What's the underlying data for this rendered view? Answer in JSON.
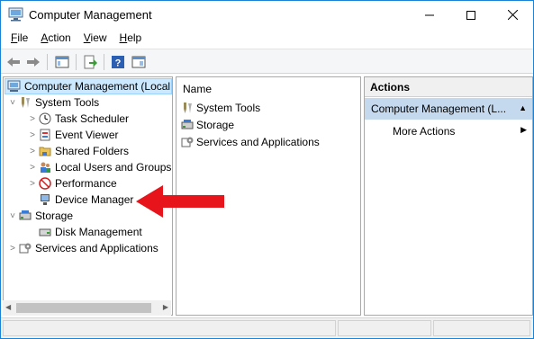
{
  "window": {
    "title": "Computer Management",
    "controls": {
      "minimize": "—",
      "maximize": "☐",
      "close": "✕"
    }
  },
  "menu": [
    {
      "label": "File",
      "key": "F",
      "rest": "ile"
    },
    {
      "label": "Action",
      "key": "A",
      "rest": "ction"
    },
    {
      "label": "View",
      "key": "V",
      "rest": "iew"
    },
    {
      "label": "Help",
      "key": "H",
      "rest": "elp"
    }
  ],
  "toolbar": {
    "buttons": [
      "back-icon",
      "forward-icon",
      "show-hide-console-tree-icon",
      "export-list-icon",
      "help-icon",
      "show-hide-action-pane-icon"
    ]
  },
  "tree": {
    "root": {
      "label": "Computer Management (Local",
      "icon": "computer-management-icon"
    },
    "items": [
      {
        "label": "System Tools",
        "icon": "system-tools-icon",
        "arrow": "˅"
      },
      {
        "label": "Task Scheduler",
        "icon": "clock-icon",
        "arrow": ">"
      },
      {
        "label": "Event Viewer",
        "icon": "event-viewer-icon",
        "arrow": ">"
      },
      {
        "label": "Shared Folders",
        "icon": "shared-folder-icon",
        "arrow": ">"
      },
      {
        "label": "Local Users and Groups",
        "icon": "users-icon",
        "arrow": ">"
      },
      {
        "label": "Performance",
        "icon": "performance-icon",
        "arrow": ">"
      },
      {
        "label": "Device Manager",
        "icon": "device-manager-icon",
        "arrow": ""
      },
      {
        "label": "Storage",
        "icon": "storage-icon",
        "arrow": "˅"
      },
      {
        "label": "Disk Management",
        "icon": "disk-management-icon",
        "arrow": ""
      },
      {
        "label": "Services and Applications",
        "icon": "services-icon",
        "arrow": ">"
      }
    ]
  },
  "list": {
    "column": "Name",
    "rows": [
      {
        "label": "System Tools",
        "icon": "system-tools-icon"
      },
      {
        "label": "Storage",
        "icon": "storage-icon"
      },
      {
        "label": "Services and Applications",
        "icon": "services-icon"
      }
    ]
  },
  "actions": {
    "header": "Actions",
    "selected": "Computer Management (L...",
    "more": "More Actions"
  },
  "colors": {
    "accent_border": "#1883d7",
    "selection": "#cce8ff",
    "actions_selected": "#c5d9ee",
    "annotation_arrow": "#e8141c"
  }
}
